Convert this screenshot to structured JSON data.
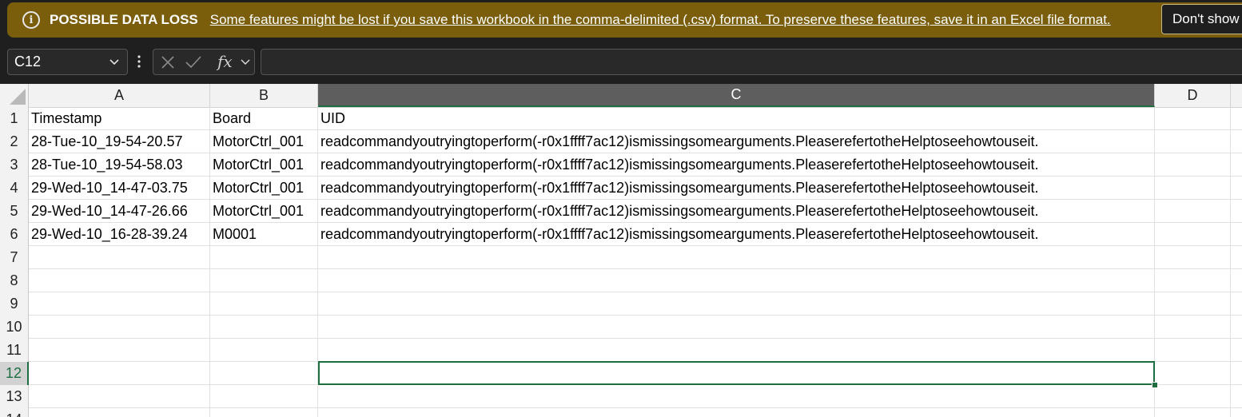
{
  "banner": {
    "title": "POSSIBLE DATA LOSS",
    "message": "Some features might be lost if you save this workbook in the comma-delimited (.csv) format. To preserve these features, save it in an Excel file format.",
    "button_label": "Don't show again",
    "icon": "info-icon",
    "color": "#7a5e0c"
  },
  "formula_bar": {
    "name_box": "C12",
    "formula": "",
    "fx_label": "fx"
  },
  "sheet": {
    "accent_color": "#1e6e42",
    "columns": [
      "A",
      "B",
      "C",
      "D"
    ],
    "selected_column": "C",
    "row_numbers": [
      "1",
      "2",
      "3",
      "4",
      "5",
      "6",
      "7",
      "8",
      "9",
      "10",
      "11",
      "12",
      "13",
      "14"
    ],
    "selected_row": "12",
    "rows": [
      [
        "Timestamp",
        "Board",
        "UID"
      ],
      [
        "28-Tue-10_19-54-20.57",
        "MotorCtrl_001",
        "readcommandyoutryingtoperform(-r0x1ffff7ac12)ismissingsomearguments.PleaserefertotheHelptoseehowtouseit."
      ],
      [
        "28-Tue-10_19-54-58.03",
        "MotorCtrl_001",
        "readcommandyoutryingtoperform(-r0x1ffff7ac12)ismissingsomearguments.PleaserefertotheHelptoseehowtouseit."
      ],
      [
        "29-Wed-10_14-47-03.75",
        "MotorCtrl_001",
        "readcommandyoutryingtoperform(-r0x1ffff7ac12)ismissingsomearguments.PleaserefertotheHelptoseehowtouseit."
      ],
      [
        "29-Wed-10_14-47-26.66",
        "MotorCtrl_001",
        "readcommandyoutryingtoperform(-r0x1ffff7ac12)ismissingsomearguments.PleaserefertotheHelptoseehowtouseit."
      ],
      [
        "29-Wed-10_16-28-39.24",
        "M0001",
        "readcommandyoutryingtoperform(-r0x1ffff7ac12)ismissingsomearguments.PleaserefertotheHelptoseehowtouseit."
      ]
    ]
  }
}
